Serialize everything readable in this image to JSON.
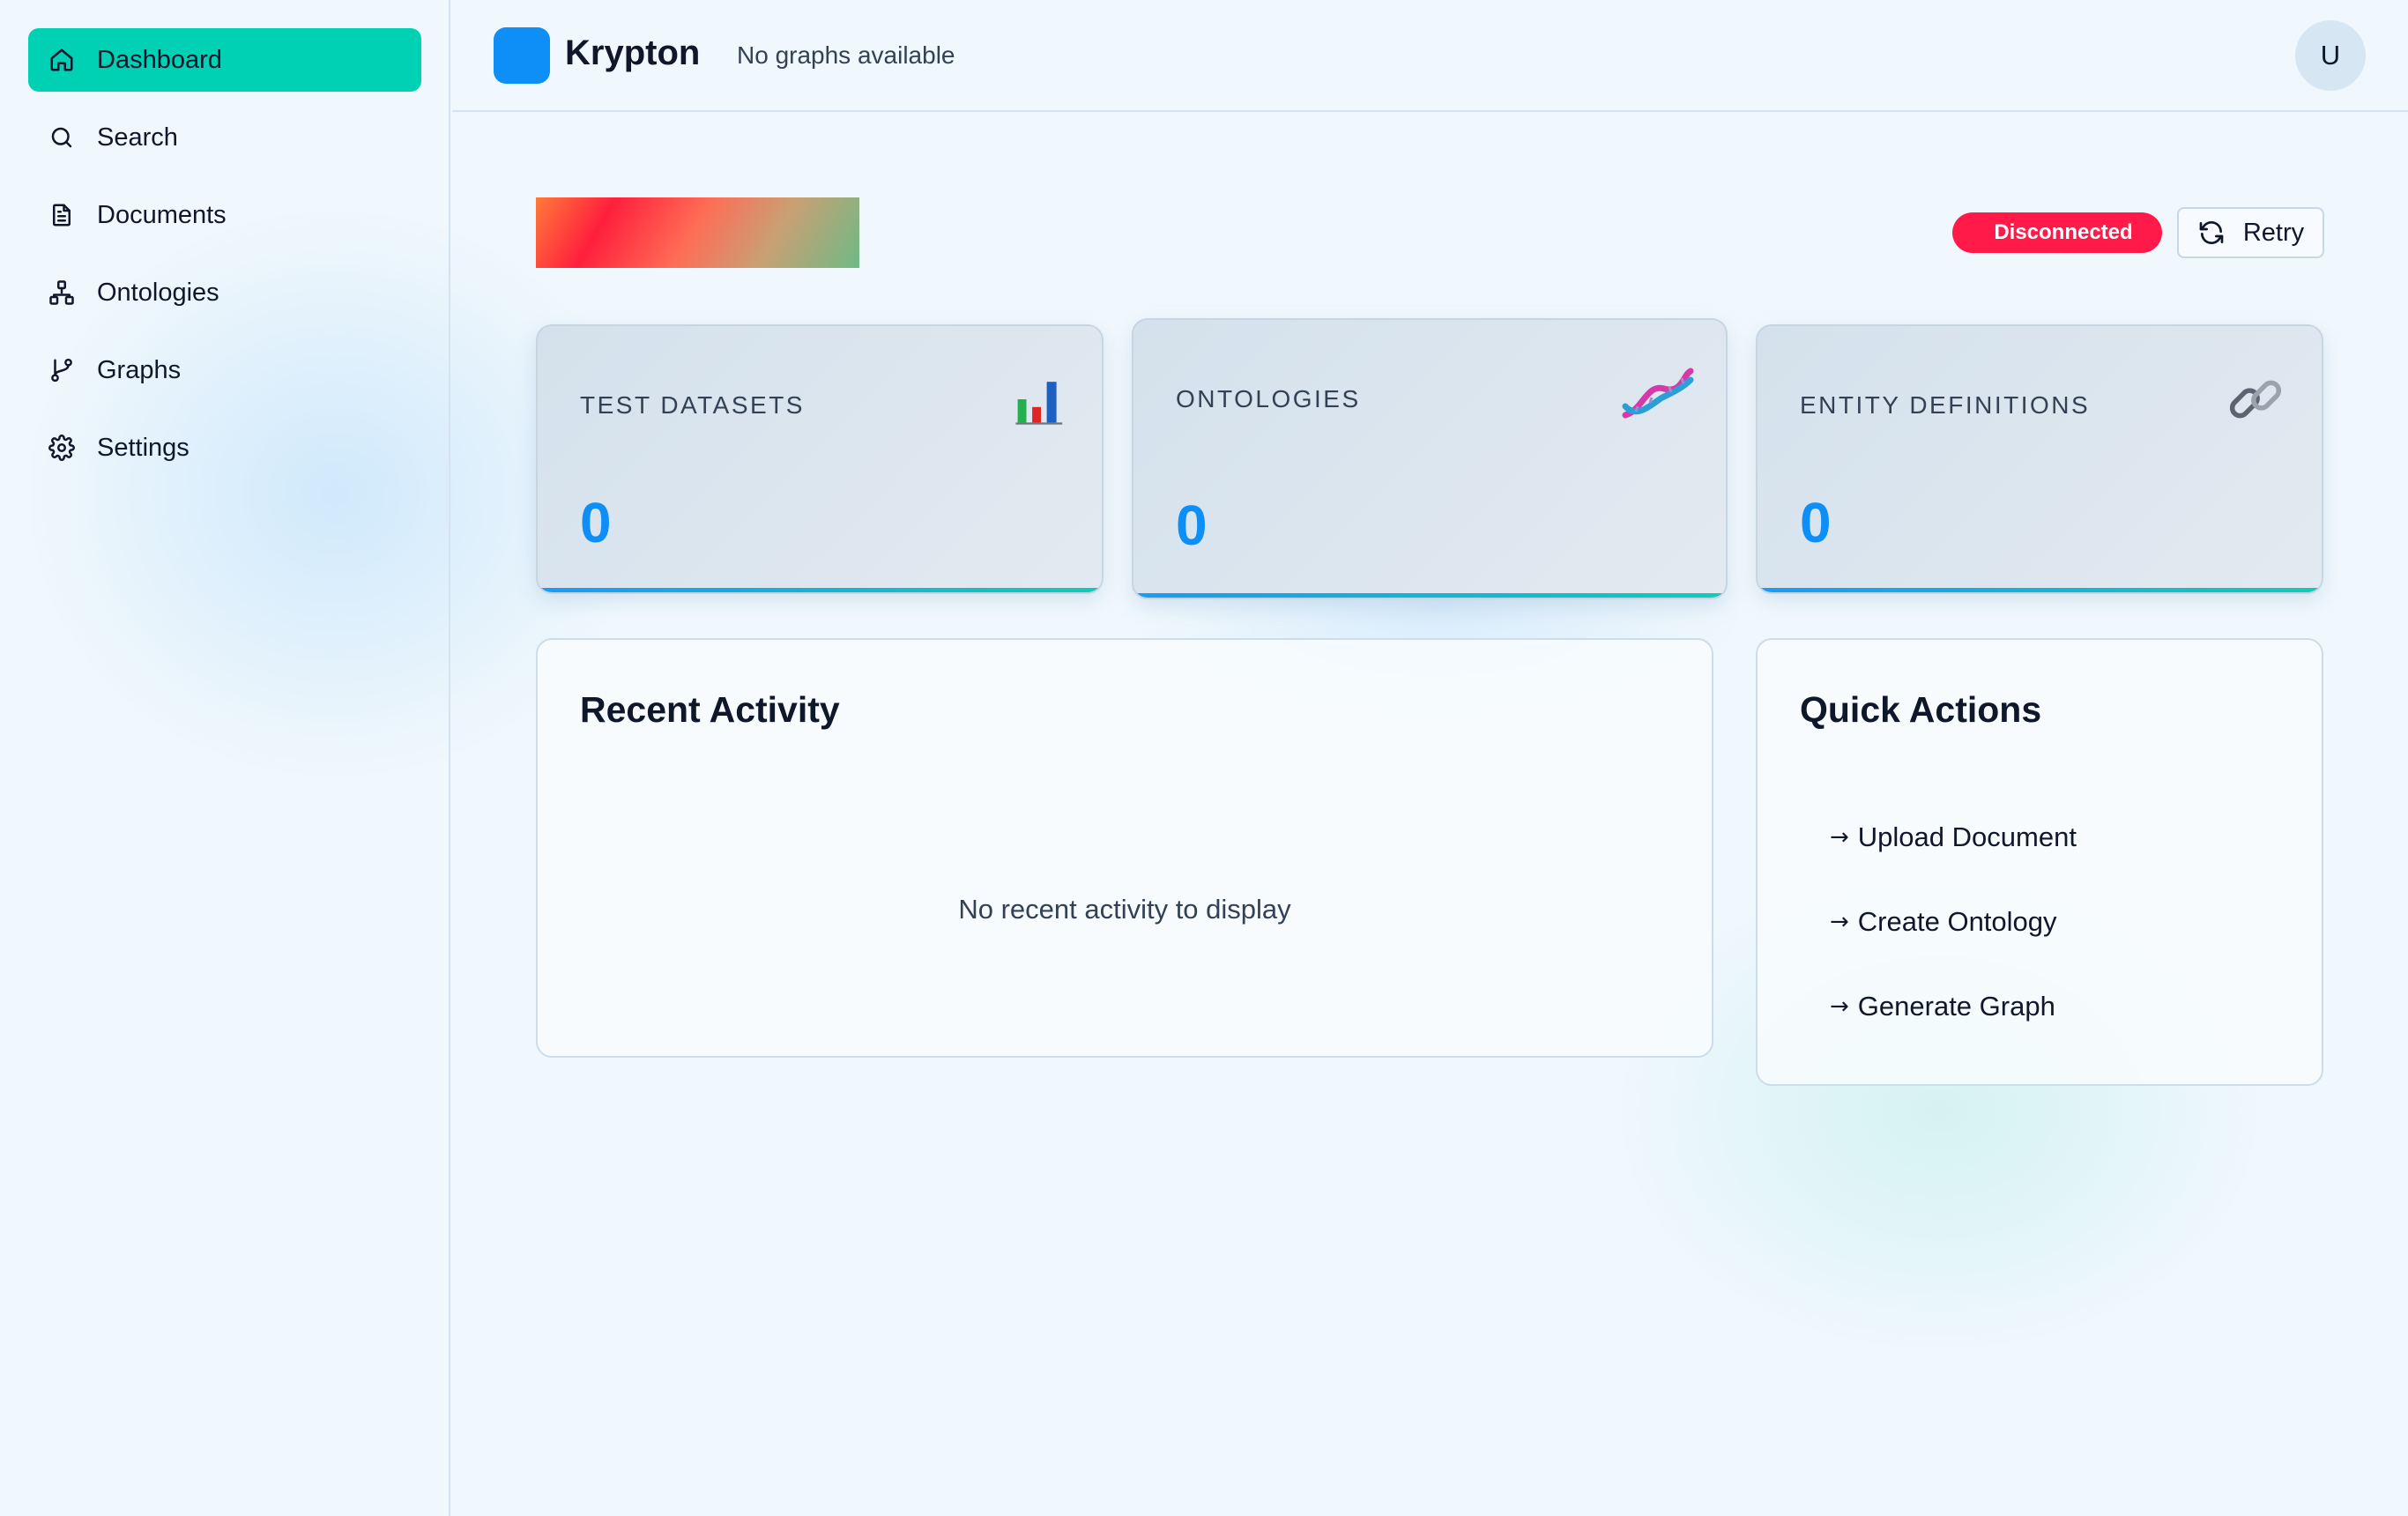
{
  "sidebar": {
    "items": [
      {
        "label": "Dashboard",
        "icon": "home-icon",
        "active": true
      },
      {
        "label": "Search",
        "icon": "search-icon"
      },
      {
        "label": "Documents",
        "icon": "document-icon"
      },
      {
        "label": "Ontologies",
        "icon": "network-icon"
      },
      {
        "label": "Graphs",
        "icon": "git-branch-icon"
      },
      {
        "label": "Settings",
        "icon": "gear-icon"
      }
    ]
  },
  "header": {
    "app_name": "Krypton",
    "graph_status": "No graphs available",
    "avatar_initial": "U"
  },
  "connection": {
    "status": "Disconnected",
    "status_color": "#ff1a4a",
    "retry_label": "Retry"
  },
  "stats": [
    {
      "title": "TEST DATASETS",
      "value": "0",
      "icon": "bar-chart-emoji-icon"
    },
    {
      "title": "ONTOLOGIES",
      "value": "0",
      "icon": "dna-emoji-icon"
    },
    {
      "title": "ENTITY DEFINITIONS",
      "value": "0",
      "icon": "link-emoji-icon"
    }
  ],
  "recent_activity": {
    "title": "Recent Activity",
    "empty_message": "No recent activity to display"
  },
  "quick_actions": {
    "title": "Quick Actions",
    "arrow": "→",
    "items": [
      {
        "label": "Upload Document"
      },
      {
        "label": "Create Ontology"
      },
      {
        "label": "Generate Graph"
      }
    ]
  },
  "colors": {
    "accent": "#00d1b4",
    "primary": "#0d8ff7",
    "danger": "#ff1a4a"
  }
}
